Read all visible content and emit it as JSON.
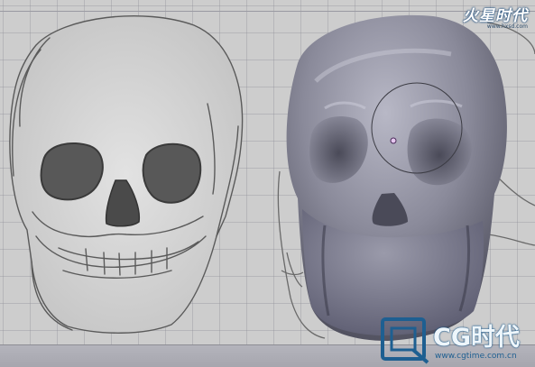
{
  "viewport": {
    "name": "sculpt-viewport"
  },
  "brush": {
    "type": "circle",
    "center_dot_color": "#e6c8f0"
  },
  "watermark_top": {
    "title": "火星时代",
    "url": "www.hxsd.com"
  },
  "watermark_bottom": {
    "title": "CG时代",
    "url": "www.cgtime.com.cn"
  },
  "colors": {
    "grid_background": "#cdcdcd",
    "sketch_line": "#5a5a5a",
    "model_light": "#a8a8b6",
    "model_dark": "#40404c",
    "watermark_blue": "#1e5f91"
  }
}
